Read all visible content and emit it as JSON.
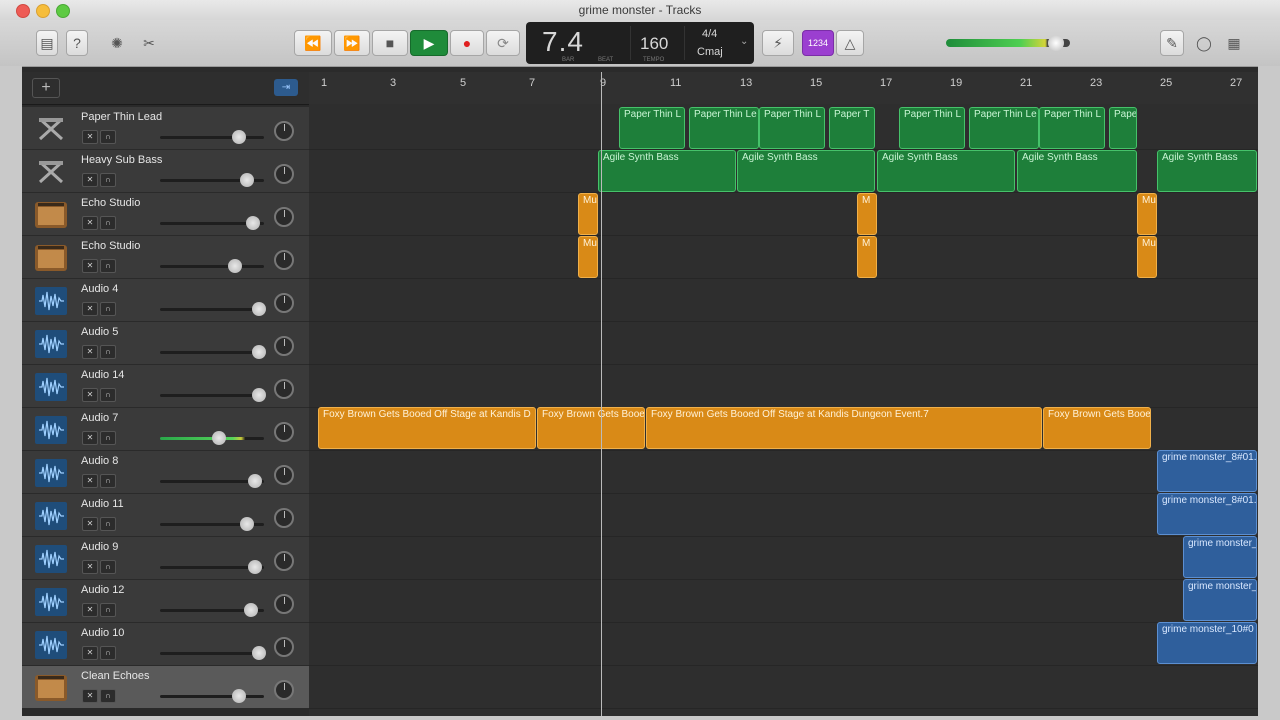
{
  "window": {
    "title": "grime monster - Tracks"
  },
  "toolbar": {
    "lcd": {
      "bar": "7.4",
      "bar_label": "BAR",
      "beat_label": "BEAT",
      "tempo": "160",
      "tempo_label": "TEMPO",
      "signature": "4/4",
      "key": "Cmaj"
    },
    "count_in": "1234"
  },
  "ruler": {
    "bars": [
      "1",
      "3",
      "5",
      "7",
      "9",
      "11",
      "13",
      "15",
      "17",
      "19",
      "21",
      "23",
      "25",
      "27"
    ]
  },
  "tracks": [
    {
      "name": "Paper Thin Lead",
      "icon": "keyboard-icon"
    },
    {
      "name": "Heavy Sub Bass",
      "icon": "keyboard-icon"
    },
    {
      "name": "Echo Studio",
      "icon": "amp-icon"
    },
    {
      "name": "Echo Studio",
      "icon": "amp-icon"
    },
    {
      "name": "Audio 4",
      "icon": "waveform-icon"
    },
    {
      "name": "Audio 5",
      "icon": "waveform-icon"
    },
    {
      "name": "Audio 14",
      "icon": "waveform-icon"
    },
    {
      "name": "Audio 7",
      "icon": "waveform-icon"
    },
    {
      "name": "Audio 8",
      "icon": "waveform-icon"
    },
    {
      "name": "Audio 11",
      "icon": "waveform-icon"
    },
    {
      "name": "Audio 9",
      "icon": "waveform-icon"
    },
    {
      "name": "Audio 12",
      "icon": "waveform-icon"
    },
    {
      "name": "Audio 10",
      "icon": "waveform-icon"
    },
    {
      "name": "Clean Echoes",
      "icon": "amp-icon"
    }
  ],
  "regions": {
    "lead": [
      "Paper Thin L",
      "Paper Thin Le",
      "Paper Thin L",
      "Paper T",
      "Paper Thin L",
      "Paper Thin Le",
      "Paper Thin L",
      "Pape"
    ],
    "bass": [
      "Agile Synth Bass",
      "Agile Synth Bass",
      "Agile Synth Bass",
      "Agile Synth Bass",
      "Agile Synth Bass"
    ],
    "echo_a": [
      "Mu",
      "M",
      "Mu"
    ],
    "echo_b": [
      "Mu",
      "M",
      "Mu"
    ],
    "audio7": [
      "Foxy Brown Gets Booed Off Stage at Kandis D",
      "Foxy Brown Gets Booe",
      "Foxy Brown Gets Booed Off Stage at Kandis Dungeon Event.7",
      "Foxy Brown Gets Booe"
    ],
    "audio8": [
      "grime monster_8#01."
    ],
    "audio11": [
      "grime monster_8#01."
    ],
    "audio9": [
      "grime monster_"
    ],
    "audio12": [
      "grime monster_"
    ],
    "audio10": [
      "grime monster_10#0"
    ]
  }
}
